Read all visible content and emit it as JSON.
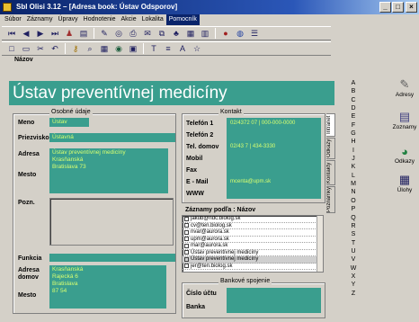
{
  "window": {
    "title": "Sbl Olisi 3.12 – [Adresa book: Ústav Odsporov]",
    "minimize_label": "_",
    "maximize_label": "□",
    "close_label": "×"
  },
  "menu": [
    "Súbor",
    "Záznamy",
    "Úpravy",
    "Hodnotenie",
    "Akcie",
    "Lokalita",
    "Pomocník"
  ],
  "toolbar1": [
    "first-icon",
    "prev-icon",
    "next-icon",
    "last-icon",
    "person-icon",
    "card-icon",
    "edit-icon",
    "filter-icon",
    "print-icon",
    "mail-icon",
    "copy-icon",
    "tree-icon",
    "grid-icon",
    "book-icon",
    "help-icon",
    "globe-icon"
  ],
  "toolbar2": [
    "new-icon",
    "open-icon",
    "cut-icon",
    "undo-icon",
    "key-icon",
    "search-icon",
    "table-icon",
    "chart-icon",
    "export-icon",
    "text-icon",
    "align-icon",
    "spell-icon",
    "star-icon"
  ],
  "header": {
    "caption": "Názov",
    "name": "Ústav preventívnej medicíny"
  },
  "left_group": {
    "title": "Osobné údaje",
    "fields": {
      "meno_label": "Meno",
      "meno_value": "Ústav",
      "priezvisko_label": "Priezvisko",
      "priezvisko_value": "Ústavná",
      "adresa_label": "Adresa",
      "adresa_value": "Ústav preventívnej medicíny\nKrasňanská\nBratislava 73",
      "mesto_label": "Mesto",
      "poznamky_label": "Pozn.",
      "funkcia_label": "Funkcia",
      "adresa_domov_label": "Adresa\ndomov",
      "adresa_domov_value": "Krasňanská\nRajecká 6\nBratislava\n87 54",
      "mesto2_label": "Mesto"
    }
  },
  "contact_group": {
    "title": "Kontakt",
    "telefon1_label": "Telefón 1",
    "telefon1_value": "02/4372 07 | 000-000-0000",
    "telefon2_label": "Telefón 2",
    "tel_domov_label": "Tel. domov",
    "tel_domov_value": "02/43 7 | 434-3330",
    "mobil_label": "Mobil",
    "fax_label": "Fax",
    "email_label": "E - Mail",
    "email_value": "mcenta@upm.sk",
    "www_label": "WWW"
  },
  "interest_list": {
    "title": "Záznamy podľa : Názov",
    "items": [
      {
        "label": "jakub@ndc.biolog.sk",
        "selected": false
      },
      {
        "label": "cv@ten.biolog.sk",
        "selected": false
      },
      {
        "label": "nvar@aurora.sk",
        "selected": false
      },
      {
        "label": "upm@aurora.sk",
        "selected": false
      },
      {
        "label": "mar@aurora.sk",
        "selected": false
      },
      {
        "label": "Ústav preventívnej medicíny",
        "selected": false
      },
      {
        "label": "Ústav preventívnej medicíny",
        "selected": true
      },
      {
        "label": "jer@ten.biolog.sk",
        "selected": false
      }
    ]
  },
  "bank_group": {
    "title": "Bankové spojenie",
    "ucet_label": "Číslo účtu",
    "banka_label": "Banka"
  },
  "vertical_tabs": [
    "Intranet",
    "Odkazy",
    "Kontakty",
    "Poznámky"
  ],
  "alphabet": [
    "A",
    "B",
    "C",
    "D",
    "E",
    "F",
    "G",
    "H",
    "I",
    "J",
    "K",
    "L",
    "M",
    "N",
    "O",
    "P",
    "Q",
    "R",
    "S",
    "T",
    "U",
    "V",
    "W",
    "X",
    "Y",
    "Z"
  ],
  "side_buttons": [
    {
      "icon": "address-book-icon",
      "label": "Adresy"
    },
    {
      "icon": "orders-icon",
      "label": "Zoznamy"
    },
    {
      "icon": "calls-icon",
      "label": "Odkazy"
    },
    {
      "icon": "tasks-icon",
      "label": "Úlohy"
    }
  ]
}
